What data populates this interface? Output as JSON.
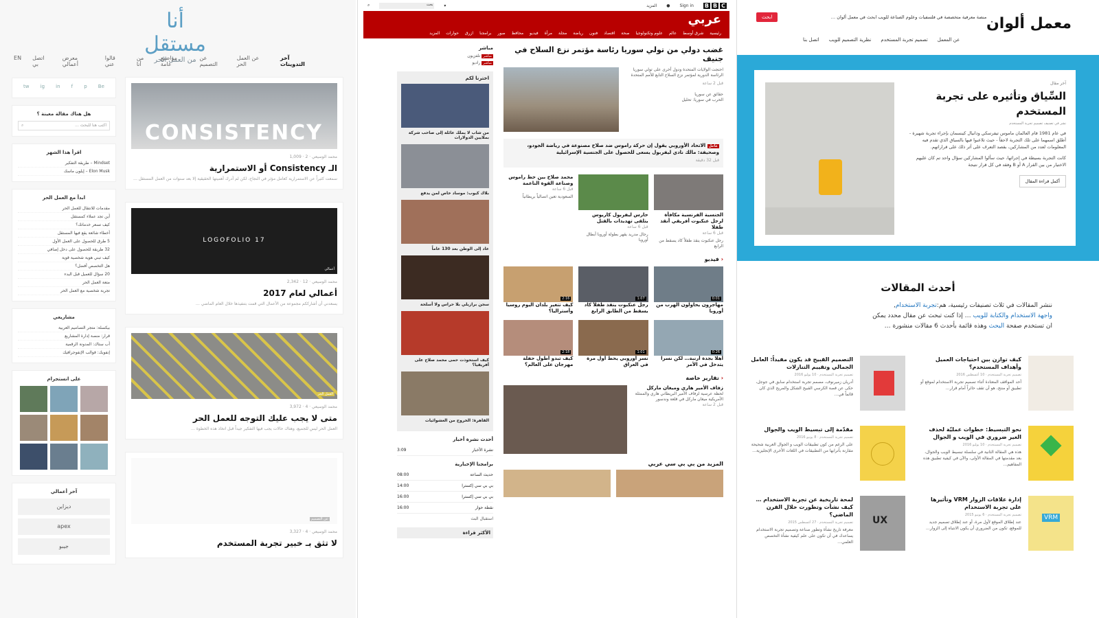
{
  "panel1": {
    "logo": {
      "main": "أنا مستقل",
      "sub": "من العمل الحر"
    },
    "nav": [
      "آخر التدوينات",
      "عن العمل الحر",
      "عن التصميم",
      "مواضيع عامة",
      "من أنا",
      "قالوا عني",
      "معرض أعمالي",
      "اتصل بي",
      "EN"
    ],
    "social": [
      "tw",
      "ig",
      "in",
      "f",
      "p",
      "Be"
    ],
    "search": {
      "title": "هل هناك مقالة معينة ؟",
      "placeholder": "اكتب هنا للبحث ..."
    },
    "most_read": {
      "title": "اقرأ هذا الشهر",
      "items": [
        "Mindset – طريقة التفكير",
        "Elon Musk – إيلون ماسك"
      ]
    },
    "freelance": {
      "title": "ابدأ مع العمل الحر",
      "items": [
        "مقدمات للانتقال للعمل الحر",
        "أين تجد عملاء كمستقل",
        "كيف تسعر خدماتك؟",
        "أخطاء شائعة يقع فيها المستقل",
        "5 طرق للحصول على العمل الأول",
        "32 طريقة للحصول على دخل إضافي",
        "كيف تبني هوية شخصية قوية",
        "هل التخصص أفضل؟",
        "20 سؤال للعميل قبل البدء",
        "متعة العمل الحر",
        "تجربة شخصية مع العمل الحر"
      ]
    },
    "projects": {
      "title": "مشاريعي",
      "items": [
        "بيكسلة: متجر التصاميم العربية",
        "قرار: منصة إدارة المشاريع",
        "أب ستاك: المدونة الرقمية",
        "إنفوبك: قوالب الإنفوجرافيك"
      ]
    },
    "instagram": {
      "title": "على انستجرام"
    },
    "works": {
      "title": "آخر أعمالي",
      "logos": [
        "ديزاين",
        "apex",
        "جيبو"
      ]
    },
    "posts": [
      {
        "title": "الـ Consistency أو الاستمرارية",
        "meta": "محمد الوسيعي · 2 · 1,009",
        "excerpt": "سمعت كثيراً عن الاستمرارية كعامل مؤثر في النجاح، لكن لم أدرك أهميتها الحقيقية إلا بعد سنوات من العمل المستقل …",
        "image_text": "CONSISTENCY"
      },
      {
        "title": "أعمالي لعام 2017",
        "meta": "محمد الوسيعي · 12 · 2,342",
        "excerpt": "يسعدني أن أشارككم مجموعة من الأعمال التي قمت بتنفيذها خلال العام الماضي …",
        "image_text": "LOGOFOLIO 17",
        "badge": "أعمالي"
      },
      {
        "title": "متى لا يجب عليك التوجه للعمل الحر",
        "meta": "محمد الوسيعي · 4 · 3,972",
        "excerpt": "العمل الحر ليس للجميع، وهناك حالات يجب فيها التفكير جيداً قبل اتخاذ هذه الخطوة …",
        "badge": "العمل الحر"
      },
      {
        "title": "لا تثق بـ خبير تجربة المستخدم",
        "meta": "محمد الوسيعي · 4 · 3,327",
        "excerpt": "",
        "badge": "عن التصميم"
      }
    ]
  },
  "panel2": {
    "topbar": {
      "sign_in": "Sign in",
      "more": "المزيد",
      "search": "بحث"
    },
    "brand": "عربي",
    "menu": [
      "رئيسية",
      "شرق أوسط",
      "عالم",
      "علوم وتكنولوجيا",
      "صحة",
      "اقتصاد",
      "فنون",
      "رياضة",
      "مجلة",
      "مرأة",
      "فيديو",
      "محافظ",
      "صور",
      "برامجنا",
      "ازرق",
      "حوارات",
      "المزيد"
    ],
    "headline": "غضب دولي من تولي سوريا رئاسة مؤتمر نزع السلاح في جنيف",
    "lead_text": "احتجت الولايات المتحدة ودول أخرى على تولي سوريا الرئاسة الدورية لمؤتمر نزع السلاح التابع للأمم المتحدة",
    "lead_time": "قبل 2 ساعة",
    "related": [
      "حقائق عن سوريا",
      "الحرب في سوريا: تحليل"
    ],
    "block_tag": "عاجل",
    "block_title": "الاتحاد الأوروبي يقول إن حركة راموس ضد صلاح مصنوعة في رياضة الجودو، وصحيفة: مالك نادي ليفربول يسعى للحصول على الجنسية الإسرائيلية",
    "block_meta": "قبل 32 دقيقة",
    "grid": [
      {
        "title": "الجنسية الفرنسية مكافأة لرجل عنكبوت أفريقي أنقذ طفلا",
        "time": "قبل 6 ساعة"
      },
      {
        "title": "حارس ليفربول كاريوس يتلقى تهديدات بالقتل",
        "time": "قبل 6 ساعة"
      },
      {
        "title": "محمد صلاح بين حظ راموس وصناعة القوة الناعمة",
        "time": "قبل 6 ساعة"
      }
    ],
    "grid_notes": [
      "رجل عنكبوت ينقذ طفلاً كاد يسقط من الرابع",
      "رجال مدريد يقهر بطولة أوروبا أبطال أوروبا",
      "السعودية تعين اتصالياً بريطانياً"
    ],
    "video_title": "فيديو",
    "videos": [
      {
        "title": "مهاجرون يحاولون الهرب من أوروبا",
        "dur": "0:01"
      },
      {
        "title": "رجل عنكبوت ينقذ طفلاً كاد يسقط من الطابق الرابع",
        "dur": "1:07"
      },
      {
        "title": "كيف تتغير بلدان اليوم روسيا وأستراليا؟",
        "dur": "2:16"
      },
      {
        "title": "أهلا بجدة أرنبة… لكن نسرا يتدخل في الأمر",
        "dur": "0:26"
      },
      {
        "title": "نسر أوروبي يحط أول مرة في العراق",
        "dur": "1:01"
      },
      {
        "title": "كيف تبدو أطول حفلة مهرجان على العالم؟",
        "dur": "2:18"
      }
    ],
    "reports_title": "تقارير خاصة",
    "report": {
      "title": "زفاف الأمير هاري وميغان ماركل",
      "text": "لحظة عرسية لزفاف الأمير البريطاني هاري والممثلة الأمريكية ميغان ماركل في قلعة وندسور",
      "time": "قبل 2 ساعة"
    },
    "more_title": "المزيد من بي بي سي عربي",
    "aside": {
      "live_title": "مباشر",
      "live_items": [
        {
          "tag": "مباشر",
          "label": "تلفزيون"
        },
        {
          "tag": "مباشر",
          "label": "راديو"
        }
      ],
      "picks_title": "اخترنا لكم",
      "picks": [
        "من شاب لا يملك عائلة إلى صاحب شركة بملايين الدولارات",
        "بلاك كيوب: موساد خاص لمن يدفع",
        "عاد إلى الوطن بعد 130 عاماً",
        "سجن برازيلي بلا حراس ولا أسلحة",
        "كيف استحوذت حمى محمد صلاح على أفريقيا؟",
        "القاهرة: الخروج من العشوائيات"
      ],
      "news_title": "أحدث نشرة أخبار",
      "news_items": [
        {
          "label": "نشرة الأخبار",
          "time": "3:09"
        }
      ],
      "programs_title": "برامجنا الإخبارية",
      "programs": [
        {
          "label": "حديث الساعة",
          "time": "08:00"
        },
        {
          "label": "بي بي سي إكسترا",
          "time": "14:00"
        },
        {
          "label": "بي بي سي إكسترا",
          "time": "16:00"
        },
        {
          "label": "نقطة حوار",
          "time": "16:00"
        }
      ],
      "schedule_link": "استقبال البث",
      "most_read": "الأكثر قراءة"
    }
  },
  "panel3": {
    "brand": "معمل ألوان",
    "tagline": "منصة معرفية متخصصة في فلسفيات وعلوم الصناعة للويب ابحث في معمل ألوان …",
    "cta": "ابحث",
    "nav": [
      "عن المعمل",
      "تصميم تجربة المستخدم",
      "نظرية التصميم للويب",
      "اتصل بنا"
    ],
    "featured": {
      "kicker": "آخر مقال",
      "title": "السِّياق وتأثيره على تجربة المستخدم",
      "meta": "نشر في تصنيف تصميم تجربة المستخدم",
      "p1": "في عام 1981 قام العالمان ماموس تيفرسكي ودانيال كينسمان بإجراء تجربة شهيرة - أطلق اسمهما على تلك التجربة لاحقاً - حيث تلاعبوا فيها بالسياق الذي تقدم فيه المعلومات لعدد من المشاركين، بقصد التعرف على أثر ذلك على قراراتهم.",
      "p2": "كانت التجربة بسيطة في إجرائها، حيث سألوا المشاركين سؤال واحد تم كان عليهم الاختيار من بين القرار A أو B وفقد في كل قرار نتيجة",
      "more": "أكمل قراءة المقال"
    },
    "latest": {
      "title": "أحدث المقالات",
      "line1": "ننشر المقالات في ثلاث تصنيفات رئيسية، هم:",
      "link1": "تجربة الاستخدام",
      "link2": "واجهة الاستخدام",
      "link3": "والكتابة للويب",
      "line2": "… إذا كنت تبحث عن مقال محدد يمكن",
      "line3": "ان تستخدم صفحة",
      "link4": "البحث",
      "line4": "وهذه قائمة بأحدث 6 مقالات منشورة …"
    },
    "articles": [
      {
        "title": "كيف توازن بين احتياجات العميل وأهداف المستخدم؟",
        "meta": "تصميم تجربة المستخدم · 10 أغسطس 2016",
        "excerpt": "أحد المواقف المعتادة أثناء تصميم تجربة الاستخدام لموقع أو تطبيق أو منتج، هو أن تقف حائراً أمام قرار…"
      },
      {
        "title": "التصميم القبيح قد يكون مفيداً: العامل الجمالي وتقييم التنازلات",
        "meta": "تصميم تجربة المستخدم · 10 يوليو 2016",
        "excerpt": "أدريان زميرنوف، مصمم تجربة استخدام سابق في جوجل، حكى عن قصة الكرسي القبيح الشكل والمريح الذي كان قائماً في…"
      },
      {
        "title": "نحو التبسيط: خطوات عمليّة لحذف الغير ضروري في الويب و الجوال",
        "meta": "تصميم تجربة المستخدم · 10 يوليو 2016",
        "excerpt": "هذه هي المقالة الثانية في سلسلة تبسيط الويب والجوال، بعد مقدمتها في المقالة الأولى، والآن في كيفية تطبيق هذه المفاهيم…"
      },
      {
        "title": "مقدّمة إلى تبسيط الويب والجوال",
        "meta": "تصميم تجربة المستخدم · 8 يونيو 2016",
        "excerpt": "على الرغم من كون تطبيقات الويب و الجوال العربية شحيحة مقارنة بأترابها من التطبيقات في اللغات الأخرى الإنجليزية…"
      },
      {
        "title": "إدارة علاقات الزوار VRM وتأثيرها على تجربة الاستخدام",
        "meta": "تصميم تجربة المستخدم · 6 يونيو 2015",
        "excerpt": "عند إطلاق الموقع لأول مرة، أو عند إطلاق تصميم جديد للموقع، تكون من الضروري أن يكون الانتباه إلى الزوار…"
      },
      {
        "title": "لمحة تاريخية عن تجربة الاستخدام … كيف نشأت وتطورت خلال القرن الماضي؟",
        "meta": "تصميم تجربة المستخدم · 27 أغسطس 2015",
        "excerpt": "معرفة تاريخ نشأة وتطور صناعة وتصميم تجربة الاستخدام يساعدك في أن تكون على علم كيفية نشأة التخصص العلمي…"
      }
    ]
  }
}
